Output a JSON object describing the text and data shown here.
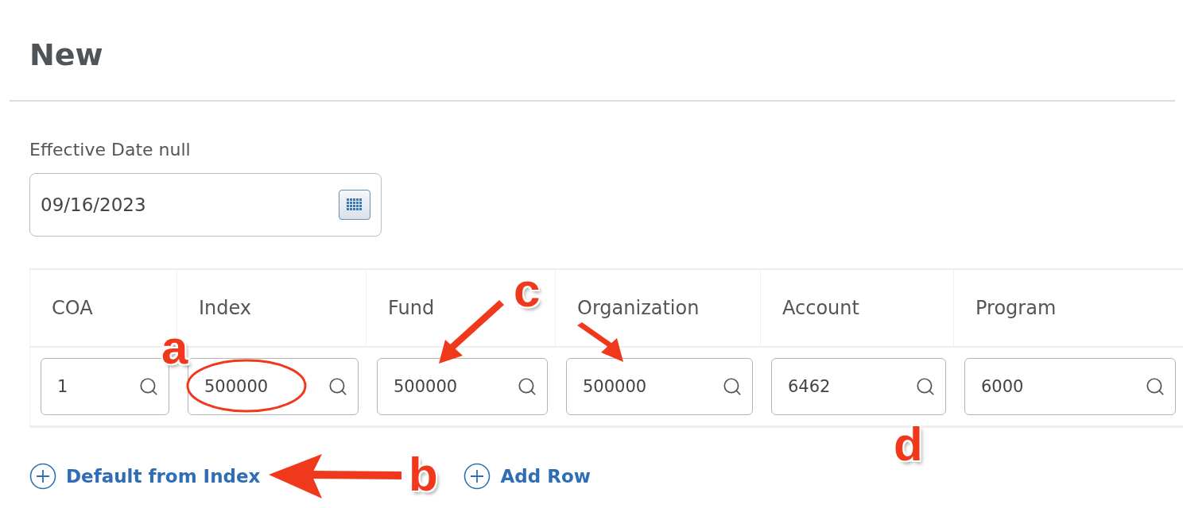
{
  "page": {
    "title": "New"
  },
  "effective_date": {
    "label": "Effective Date null",
    "value": "09/16/2023"
  },
  "table": {
    "columns": [
      "COA",
      "Index",
      "Fund",
      "Organization",
      "Account",
      "Program"
    ],
    "rows": [
      [
        "1",
        "500000",
        "500000",
        "500000",
        "6462",
        "6000"
      ]
    ]
  },
  "actions": [
    {
      "label": "Default from Index"
    },
    {
      "label": "Add Row"
    }
  ],
  "annotations": [
    {
      "label": "a"
    },
    {
      "label": "b"
    },
    {
      "label": "c"
    },
    {
      "label": "d"
    }
  ]
}
